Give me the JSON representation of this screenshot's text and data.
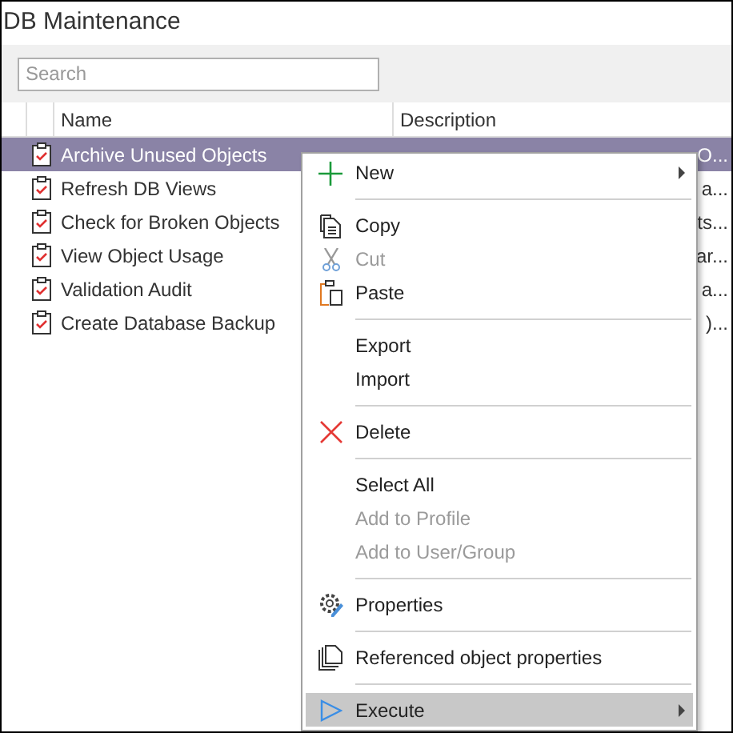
{
  "window": {
    "title": "DB Maintenance"
  },
  "search": {
    "placeholder": "Search"
  },
  "table": {
    "columns": [
      "Name",
      "Description"
    ],
    "rows": [
      {
        "name": "Archive Unused Objects",
        "description": "O...",
        "selected": true
      },
      {
        "name": "Refresh DB Views",
        "description": "a...",
        "selected": false
      },
      {
        "name": "Check for Broken Objects",
        "description": "ts...",
        "selected": false
      },
      {
        "name": "View Object Usage",
        "description": "ar...",
        "selected": false
      },
      {
        "name": "Validation Audit",
        "description": "a...",
        "selected": false
      },
      {
        "name": "Create Database Backup",
        "description": ")...",
        "selected": false
      }
    ]
  },
  "context_menu": {
    "items": [
      {
        "kind": "item",
        "label": "New",
        "disabled": false,
        "submenu": true,
        "selected": false
      },
      {
        "kind": "separator"
      },
      {
        "kind": "item",
        "label": "Copy",
        "disabled": false,
        "submenu": false,
        "selected": false
      },
      {
        "kind": "item",
        "label": "Cut",
        "disabled": true,
        "submenu": false,
        "selected": false
      },
      {
        "kind": "item",
        "label": "Paste",
        "disabled": false,
        "submenu": false,
        "selected": false
      },
      {
        "kind": "separator"
      },
      {
        "kind": "item",
        "label": "Export",
        "disabled": false,
        "submenu": false,
        "selected": false
      },
      {
        "kind": "item",
        "label": "Import",
        "disabled": false,
        "submenu": false,
        "selected": false
      },
      {
        "kind": "separator"
      },
      {
        "kind": "item",
        "label": "Delete",
        "disabled": false,
        "submenu": false,
        "selected": false
      },
      {
        "kind": "separator"
      },
      {
        "kind": "item",
        "label": "Select All",
        "disabled": false,
        "submenu": false,
        "selected": false
      },
      {
        "kind": "item",
        "label": "Add to Profile",
        "disabled": true,
        "submenu": false,
        "selected": false
      },
      {
        "kind": "item",
        "label": "Add to User/Group",
        "disabled": true,
        "submenu": false,
        "selected": false
      },
      {
        "kind": "separator"
      },
      {
        "kind": "item",
        "label": "Properties",
        "disabled": false,
        "submenu": false,
        "selected": false
      },
      {
        "kind": "separator"
      },
      {
        "kind": "item",
        "label": "Referenced object properties",
        "disabled": false,
        "submenu": false,
        "selected": false
      },
      {
        "kind": "separator"
      },
      {
        "kind": "item",
        "label": "Execute",
        "disabled": false,
        "submenu": true,
        "selected": true
      }
    ]
  }
}
